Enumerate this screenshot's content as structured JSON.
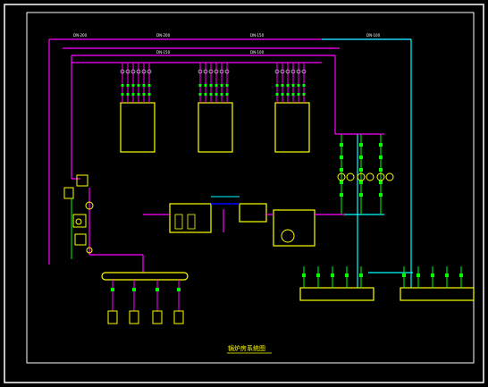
{
  "drawing": {
    "title": "锅炉房系统图",
    "colors": {
      "background": "#000000",
      "frame": "#ffffff",
      "steam": "#ff00ff",
      "water": "#00ffff",
      "equipment": "#ffff00",
      "valves": "#00ff00",
      "blue_pipe": "#0000ff"
    },
    "header_labels": [
      "DN-200",
      "DN-200",
      "DN-150",
      "DN-150",
      "DN-100",
      "DN-100"
    ]
  }
}
